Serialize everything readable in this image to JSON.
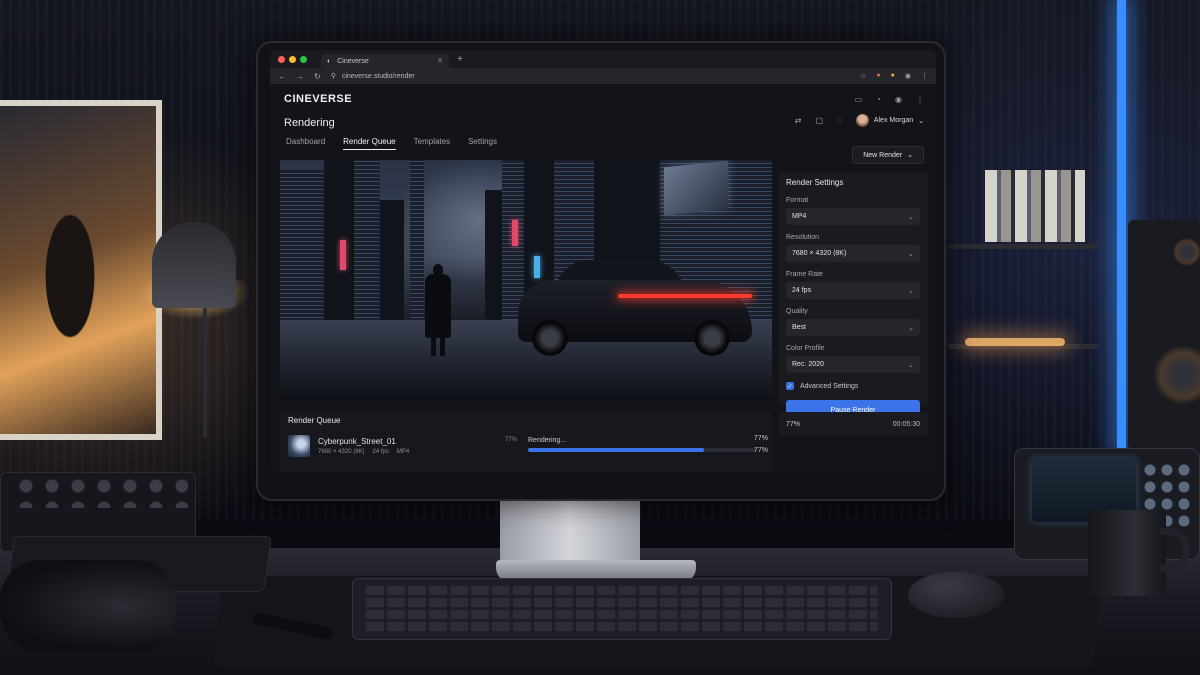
{
  "browser": {
    "tab_title": "Cineverse",
    "url": "cineverse.studio/render",
    "colors": {
      "close": "#ff5f56",
      "minimize": "#ffbd2e",
      "maximize": "#27c93f"
    }
  },
  "app": {
    "logo": "CINEVERSE",
    "page_title": "Rendering",
    "user_name": "Alex Morgan",
    "tabs": [
      {
        "label": "Dashboard",
        "active": false
      },
      {
        "label": "Render Queue",
        "active": true
      },
      {
        "label": "Templates",
        "active": false
      },
      {
        "label": "Settings",
        "active": false
      }
    ],
    "new_render_label": "New Render",
    "accent": "#3d73e8"
  },
  "settings": {
    "title": "Render Settings",
    "fields": [
      {
        "label": "Format",
        "value": "MP4"
      },
      {
        "label": "Resolution",
        "value": "7680 × 4320 (8K)"
      },
      {
        "label": "Frame Rate",
        "value": "24 fps"
      },
      {
        "label": "Quality",
        "value": "Best"
      },
      {
        "label": "Color Profile",
        "value": "Rec. 2020"
      }
    ],
    "advanced_label": "Advanced Settings",
    "advanced_checked": true,
    "pause_label": "Pause Render"
  },
  "queue": {
    "title": "Render Queue",
    "items": [
      {
        "name": "Cyberpunk_Street_01",
        "resolution": "7680 × 4320 (8K)",
        "fps": "24 fps",
        "format": "MP4",
        "status": "Rendering...",
        "progress_label": "77%",
        "progress_label_2": "77%",
        "progress": 0.77,
        "side_label": "77%"
      }
    ]
  },
  "summary": {
    "percent": "77%",
    "eta": "00:05:30"
  }
}
